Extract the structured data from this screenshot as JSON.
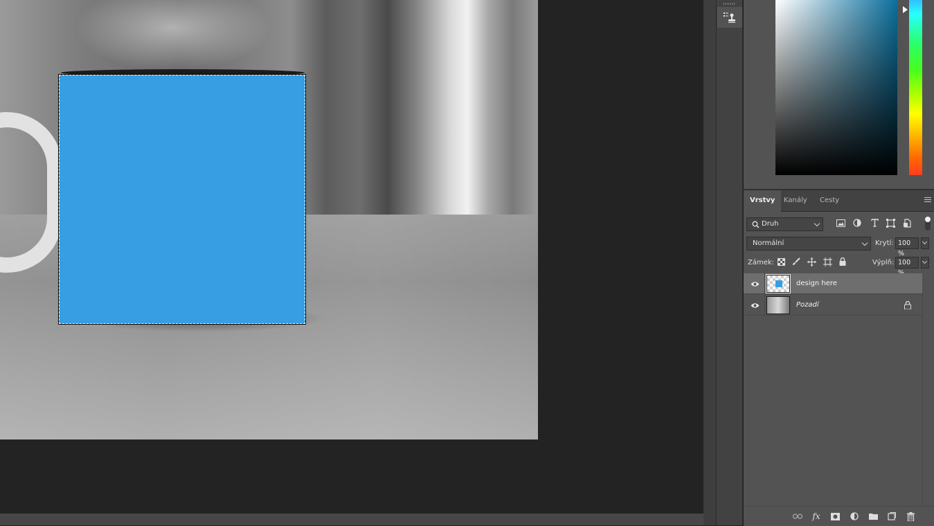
{
  "app": "Adobe Photoshop",
  "canvas": {
    "design_fill_color": "#389ee3",
    "background_style": "grayscale coffee mug photo"
  },
  "color_picker": {
    "base_hue_color": "#0b6f9c"
  },
  "layers_panel": {
    "tabs": [
      {
        "label": "Vrstvy",
        "active": true
      },
      {
        "label": "Kanály",
        "active": false
      },
      {
        "label": "Cesty",
        "active": false
      }
    ],
    "filter": {
      "label": "Druh"
    },
    "blend_mode": {
      "label": "Normální"
    },
    "opacity": {
      "label": "Krytí:",
      "value": "100 %"
    },
    "lock": {
      "label": "Zámek:"
    },
    "fill": {
      "label": "Výplň:",
      "value": "100 %"
    },
    "layers": [
      {
        "name": "design here",
        "visible": true,
        "selected": true,
        "locked": false,
        "thumb": "transparent-with-blue-square"
      },
      {
        "name": "Pozadí",
        "visible": true,
        "selected": false,
        "locked": true,
        "thumb": "photo"
      }
    ],
    "footer_icons": [
      "link-icon",
      "fx-icon",
      "mask-icon",
      "adjustment-icon",
      "group-folder-icon",
      "new-layer-icon",
      "trash-icon"
    ],
    "filter_icons": [
      "pixel-filter-icon",
      "adjustment-filter-icon",
      "type-filter-icon",
      "shape-filter-icon",
      "smart-object-filter-icon"
    ],
    "lock_icons": [
      "lock-transparent-icon",
      "lock-paint-icon",
      "lock-move-icon",
      "lock-artboard-icon",
      "lock-all-icon"
    ]
  }
}
